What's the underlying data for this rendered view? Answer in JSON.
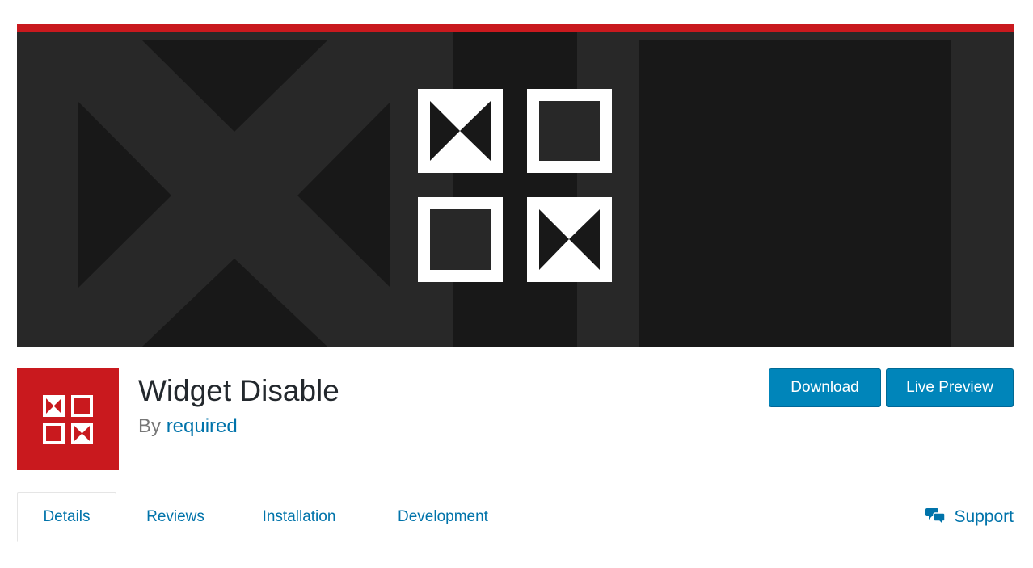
{
  "plugin": {
    "name": "Widget Disable",
    "author_prefix": "By",
    "author": "required"
  },
  "actions": {
    "download_label": "Download",
    "preview_label": "Live Preview"
  },
  "tabs": [
    {
      "label": "Details",
      "active": true
    },
    {
      "label": "Reviews",
      "active": false
    },
    {
      "label": "Installation",
      "active": false
    },
    {
      "label": "Development",
      "active": false
    }
  ],
  "support": {
    "label": "Support",
    "icon": "speech-bubbles-icon"
  },
  "colors": {
    "brand_red": "#c9191e",
    "banner_dark": "#282828",
    "link_blue": "#0073aa",
    "button_blue": "#0085ba"
  }
}
